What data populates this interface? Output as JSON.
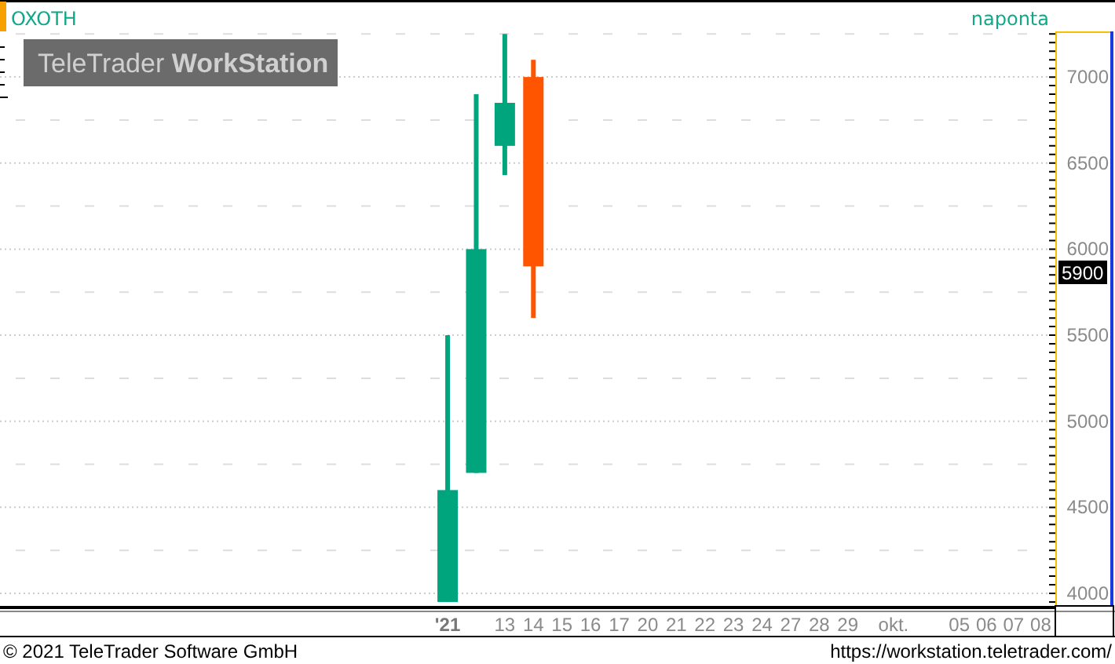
{
  "chart": {
    "instrument": "OXOTH",
    "interval": "naponta",
    "logo": {
      "brand": "TeleTrader",
      "product": "WorkStation"
    },
    "last_price": "5900",
    "price_labels": [
      "7000",
      "6500",
      "6000",
      "5500",
      "5000",
      "4500",
      "4000"
    ],
    "date_labels": [
      {
        "label": "'21",
        "kind": "year"
      },
      {
        "label": "13",
        "kind": "day"
      },
      {
        "label": "14",
        "kind": "day"
      },
      {
        "label": "15",
        "kind": "day"
      },
      {
        "label": "16",
        "kind": "day"
      },
      {
        "label": "17",
        "kind": "day"
      },
      {
        "label": "20",
        "kind": "day"
      },
      {
        "label": "21",
        "kind": "day"
      },
      {
        "label": "22",
        "kind": "day"
      },
      {
        "label": "23",
        "kind": "day"
      },
      {
        "label": "24",
        "kind": "day"
      },
      {
        "label": "27",
        "kind": "day"
      },
      {
        "label": "28",
        "kind": "day"
      },
      {
        "label": "29",
        "kind": "day"
      },
      {
        "label": "okt.",
        "kind": "month"
      },
      {
        "label": "05",
        "kind": "day"
      },
      {
        "label": "06",
        "kind": "day"
      },
      {
        "label": "07",
        "kind": "day"
      },
      {
        "label": "08",
        "kind": "day"
      }
    ]
  },
  "footer": {
    "copyright": "© 2021 TeleTrader Software GmbH",
    "url": "https://workstation.teletrader.com/"
  }
}
